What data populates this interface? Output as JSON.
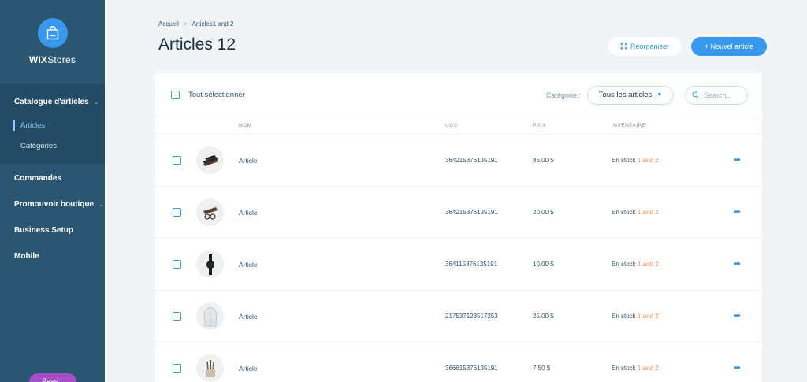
{
  "sidebar": {
    "brand_bold": "WIX",
    "brand_rest": "Stores",
    "catalog": {
      "label": "Catalogue d'articles",
      "items": [
        "Articles",
        "Catégories"
      ]
    },
    "nav": [
      {
        "label": "Commandes",
        "has_chevron": false
      },
      {
        "label": "Promouvoir boutique",
        "has_chevron": true
      },
      {
        "label": "Business Setup",
        "has_chevron": false
      },
      {
        "label": "Mobile",
        "has_chevron": false
      }
    ],
    "upgrade_label": "Pass..."
  },
  "header": {
    "breadcrumb": [
      "Accueil",
      "Articles1 and 2"
    ],
    "title": "Articles 12",
    "reorganize_label": "Réorganiser",
    "new_article_label": "+ Nouvel article"
  },
  "toolbar": {
    "select_all_label": "Tout sélectionner",
    "category_label": "Catégorie :",
    "category_value": "Tous les articles",
    "search_placeholder": "Search..."
  },
  "table": {
    "headers": {
      "name": "NOM",
      "sku": "UGS",
      "price": "PRIX",
      "inventory": "INVENTAIRE"
    },
    "rows": [
      {
        "name": "Article",
        "sku": "364215376135191",
        "price": "85,00 $",
        "stock": "En stock ",
        "stock_hl": "1 and 2",
        "icon": "wallet-icon"
      },
      {
        "name": "Article",
        "sku": "364215376135191",
        "price": "20,00 $",
        "stock": "En stock ",
        "stock_hl": "1 and 2",
        "icon": "glasses-icon"
      },
      {
        "name": "Article",
        "sku": "364115376135191",
        "price": "10,00 $",
        "stock": "En stock ",
        "stock_hl": "1 and 2",
        "icon": "watch-icon"
      },
      {
        "name": "Article",
        "sku": "217537123517253",
        "price": "25,00 $",
        "stock": "En stock ",
        "stock_hl": "1 and 2",
        "icon": "hoodie-icon"
      },
      {
        "name": "Article",
        "sku": "366615376135191",
        "price": "7,50 $",
        "stock": "En stock ",
        "stock_hl": "1 and 2",
        "icon": "brushes-icon"
      }
    ]
  },
  "colors": {
    "sidebar": "#2b5672",
    "accent": "#3899ec",
    "stock_highlight": "#f2884a",
    "upgrade": "#aa4dc8"
  }
}
